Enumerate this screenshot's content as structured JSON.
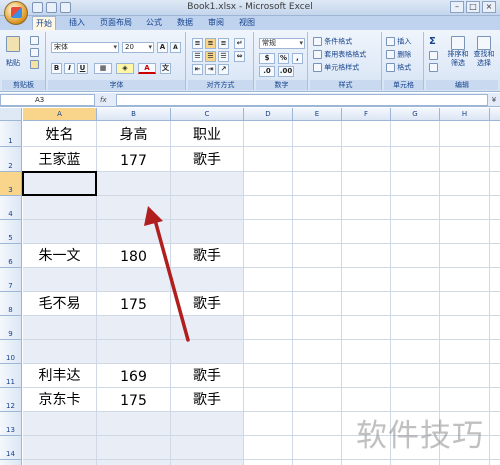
{
  "window": {
    "title": "Book1.xlsx - Microsoft Excel",
    "controls": [
      "–",
      "□",
      "×"
    ]
  },
  "tabs": [
    "开始",
    "插入",
    "页面布局",
    "公式",
    "数据",
    "审阅",
    "视图"
  ],
  "active_tab": "开始",
  "ribbon": {
    "clipboard": {
      "label": "剪贴板",
      "paste": "粘贴"
    },
    "font": {
      "label": "字体",
      "font_name": "宋体",
      "font_size": "20",
      "bold": "B",
      "italic": "I",
      "underline": "U",
      "grow": "A",
      "shrink": "A",
      "font_color": "A"
    },
    "alignment": {
      "label": "对齐方式"
    },
    "number": {
      "label": "数字",
      "format": "常规",
      "percent": "%",
      "comma": ","
    },
    "styles": {
      "label": "样式",
      "conditional": "条件格式",
      "table": "套用表格格式",
      "cell_styles": "单元格样式"
    },
    "cells": {
      "label": "单元格",
      "insert": "插入",
      "delete": "删除",
      "format": "格式"
    },
    "editing": {
      "label": "编辑",
      "sum": "Σ",
      "sort": "排序和\n筛选",
      "find": "查找和\n选择"
    }
  },
  "formula_bar": {
    "name_box": "A3",
    "fx": "fx",
    "value": ""
  },
  "columns": [
    "A",
    "B",
    "C",
    "D",
    "E",
    "F",
    "G",
    "H",
    "I"
  ],
  "rows": [
    {
      "num": "1",
      "a": "姓名",
      "b": "身高",
      "c": "职业"
    },
    {
      "num": "2",
      "a": "王家蓝",
      "b": "177",
      "c": "歌手"
    },
    {
      "num": "3",
      "a": "",
      "b": "",
      "c": ""
    },
    {
      "num": "4",
      "a": "",
      "b": "",
      "c": ""
    },
    {
      "num": "5",
      "a": "",
      "b": "",
      "c": ""
    },
    {
      "num": "6",
      "a": "朱一文",
      "b": "180",
      "c": "歌手"
    },
    {
      "num": "7",
      "a": "",
      "b": "",
      "c": ""
    },
    {
      "num": "8",
      "a": "毛不易",
      "b": "175",
      "c": "歌手"
    },
    {
      "num": "9",
      "a": "",
      "b": "",
      "c": ""
    },
    {
      "num": "10",
      "a": "",
      "b": "",
      "c": ""
    },
    {
      "num": "11",
      "a": "利丰达",
      "b": "169",
      "c": "歌手"
    },
    {
      "num": "12",
      "a": "京东卡",
      "b": "175",
      "c": "歌手"
    },
    {
      "num": "13",
      "a": "",
      "b": "",
      "c": ""
    },
    {
      "num": "14",
      "a": "",
      "b": "",
      "c": ""
    },
    {
      "num": "15",
      "a": "",
      "b": "",
      "c": ""
    }
  ],
  "active_cell": "A3",
  "watermark": "软件技巧",
  "colors": {
    "arrow": "#b01e1e",
    "accent": "#15428b",
    "band": "#e8edf6"
  }
}
